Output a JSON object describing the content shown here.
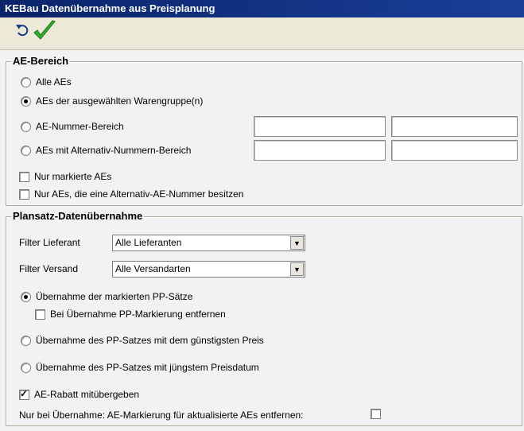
{
  "window": {
    "title": "KEBau  Datenübernahme aus Preisplanung"
  },
  "toolbar": {
    "undo_icon": "undo-icon",
    "ok_icon": "check-icon"
  },
  "ae_bereich": {
    "title": "AE-Bereich",
    "options": {
      "alle": "Alle AEs",
      "warengruppe": "AEs der ausgewählten Warengruppe(n)",
      "nummer": "AE-Nummer-Bereich",
      "alternativ": "AEs mit Alternativ-Nummern-Bereich"
    },
    "selected": "warengruppe",
    "checkboxes": {
      "markiert": "Nur markierte AEs",
      "alt_nummer": "Nur AEs, die eine Alternativ-AE-Nummer besitzen"
    },
    "inputs": {
      "nummer_von": "",
      "nummer_bis": "",
      "alt_von": "",
      "alt_bis": ""
    }
  },
  "plansatz": {
    "title": "Plansatz-Datenübernahme",
    "filter_lieferant": {
      "label": "Filter Lieferant",
      "value": "Alle Lieferanten"
    },
    "filter_versand": {
      "label": "Filter Versand",
      "value": "Alle Versandarten"
    },
    "options": {
      "markierte": "Übernahme der markierten PP-Sätze",
      "guenstigster": "Übernahme des PP-Satzes mit dem günstigsten Preis",
      "juengster": "Übernahme des PP-Satzes mit jüngstem Preisdatum"
    },
    "selected": "markierte",
    "pp_markierung": "Bei Übernahme PP-Markierung entfernen",
    "rabatt": "AE-Rabatt mitübergeben",
    "markierung_label": "Nur bei Übernahme: AE-Markierung für aktualisierte AEs entfernen:"
  }
}
